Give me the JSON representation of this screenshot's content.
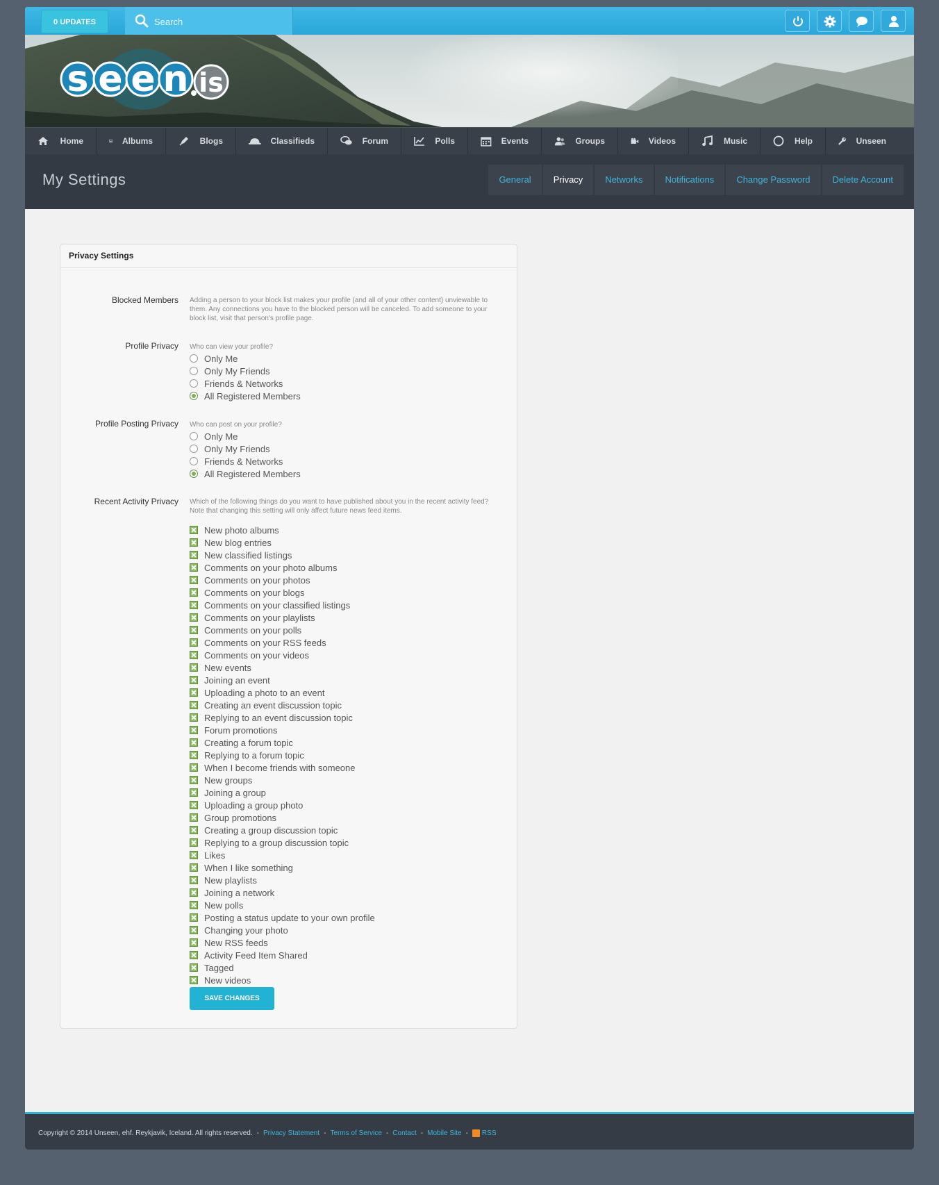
{
  "topbar": {
    "updates_label": "0 UPDATES",
    "search_placeholder": "Search",
    "icons": [
      "power-icon",
      "gear-icon",
      "chat-icon",
      "user-icon"
    ]
  },
  "brand": {
    "logo_text": "seen.is"
  },
  "nav": {
    "items": [
      {
        "label": "Home",
        "icon": "home-icon"
      },
      {
        "label": "Albums",
        "icon": "image-icon"
      },
      {
        "label": "Blogs",
        "icon": "pen-icon"
      },
      {
        "label": "Classifieds",
        "icon": "hat-icon"
      },
      {
        "label": "Forum",
        "icon": "comments-icon"
      },
      {
        "label": "Polls",
        "icon": "chart-icon"
      },
      {
        "label": "Events",
        "icon": "calendar-icon"
      },
      {
        "label": "Groups",
        "icon": "group-icon"
      },
      {
        "label": "Videos",
        "icon": "video-icon"
      },
      {
        "label": "Music",
        "icon": "music-icon"
      },
      {
        "label": "Help",
        "icon": "circle-icon"
      },
      {
        "label": "Unseen",
        "icon": "wrench-icon"
      }
    ]
  },
  "page": {
    "title": "My Settings",
    "tabs": [
      "General",
      "Privacy",
      "Networks",
      "Notifications",
      "Change Password",
      "Delete Account"
    ],
    "active_tab": "Privacy"
  },
  "panel": {
    "title": "Privacy Settings",
    "blocked": {
      "label": "Blocked Members",
      "description": "Adding a person to your block list makes your profile (and all of your other content) unviewable to them. Any connections you have to the blocked person will be canceled. To add someone to your block list, visit that person's profile page."
    },
    "profile_privacy": {
      "label": "Profile Privacy",
      "question": "Who can view your profile?",
      "options": [
        "Only Me",
        "Only My Friends",
        "Friends & Networks",
        "All Registered Members"
      ],
      "selected": "All Registered Members"
    },
    "posting_privacy": {
      "label": "Profile Posting Privacy",
      "question": "Who can post on your profile?",
      "options": [
        "Only Me",
        "Only My Friends",
        "Friends & Networks",
        "All Registered Members"
      ],
      "selected": "All Registered Members"
    },
    "activity_privacy": {
      "label": "Recent Activity Privacy",
      "description": "Which of the following things do you want to have published about you in the recent activity feed? Note that changing this setting will only affect future news feed items.",
      "items": [
        "New photo albums",
        "New blog entries",
        "New classified listings",
        "Comments on your photo albums",
        "Comments on your photos",
        "Comments on your blogs",
        "Comments on your classified listings",
        "Comments on your playlists",
        "Comments on your polls",
        "Comments on your RSS feeds",
        "Comments on your videos",
        "New events",
        "Joining an event",
        "Uploading a photo to an event",
        "Creating an event discussion topic",
        "Replying to an event discussion topic",
        "Forum promotions",
        "Creating a forum topic",
        "Replying to a forum topic",
        "When I become friends with someone",
        "New groups",
        "Joining a group",
        "Uploading a group photo",
        "Group promotions",
        "Creating a group discussion topic",
        "Replying to a group discussion topic",
        "Likes",
        "When I like something",
        "New playlists",
        "Joining a network",
        "New polls",
        "Posting a status update to your own profile",
        "Changing your photo",
        "New RSS feeds",
        "Activity Feed Item Shared",
        "Tagged",
        "New videos"
      ]
    },
    "save_label": "SAVE CHANGES"
  },
  "footer": {
    "copyright": "Copyright © 2014 Unseen, ehf. Reykjavik, Iceland. All rights reserved.",
    "links": [
      "Privacy Statement",
      "Terms of Service",
      "Contact",
      "Mobile Site",
      "RSS"
    ]
  },
  "colors": {
    "accent": "#2bb4d8",
    "topbar": "#3fb8e6",
    "nav_bg": "#3a4049",
    "subheader_bg": "#333a43",
    "check_green": "#8cbf62"
  }
}
